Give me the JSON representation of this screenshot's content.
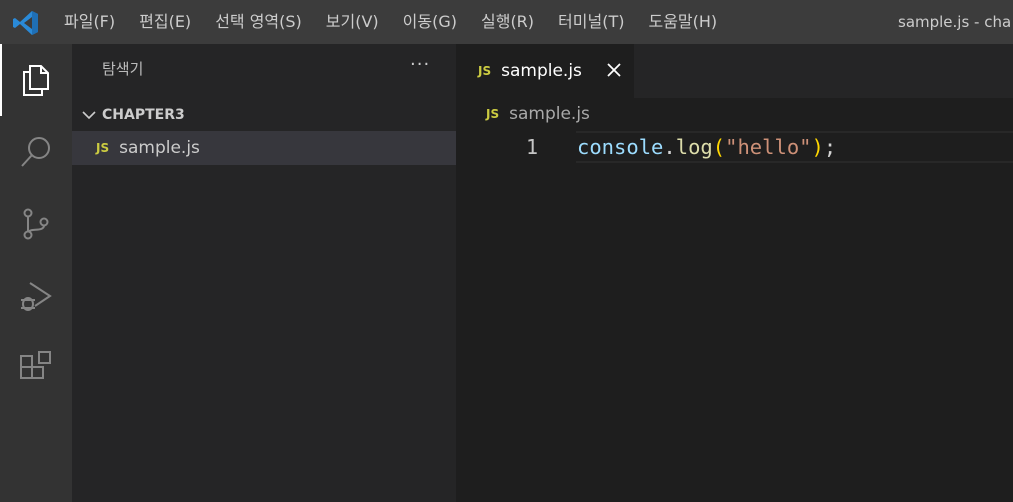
{
  "menu": {
    "items": [
      "파일(F)",
      "편집(E)",
      "선택 영역(S)",
      "보기(V)",
      "이동(G)",
      "실행(R)",
      "터미널(T)",
      "도움말(H)"
    ]
  },
  "window_title": "sample.js - cha",
  "sidebar": {
    "title": "탐색기",
    "more": "···",
    "folder": "CHAPTER3",
    "files": [
      {
        "badge": "JS",
        "name": "sample.js"
      }
    ]
  },
  "editor": {
    "tab": {
      "badge": "JS",
      "label": "sample.js"
    },
    "breadcrumb": {
      "badge": "JS",
      "label": "sample.js"
    },
    "line_number": "1",
    "code_tokens": {
      "obj": "console",
      "dot": ".",
      "fn": "log",
      "open": "(",
      "str": "\"hello\"",
      "close": ")",
      "semi": ";"
    }
  },
  "colors": {
    "accent": "#007acc",
    "js_badge": "#cbcb41",
    "titlebar": "#3c3c3c",
    "activitybar": "#333333",
    "sidebar": "#252526",
    "editor": "#1e1e1e"
  },
  "icons": {
    "app": "vscode-logo-icon",
    "activity": [
      "explorer-icon",
      "search-icon",
      "source-control-icon",
      "run-debug-icon",
      "extensions-icon"
    ],
    "folder_toggle": "chevron-down-icon",
    "tab_close": "close-icon"
  }
}
